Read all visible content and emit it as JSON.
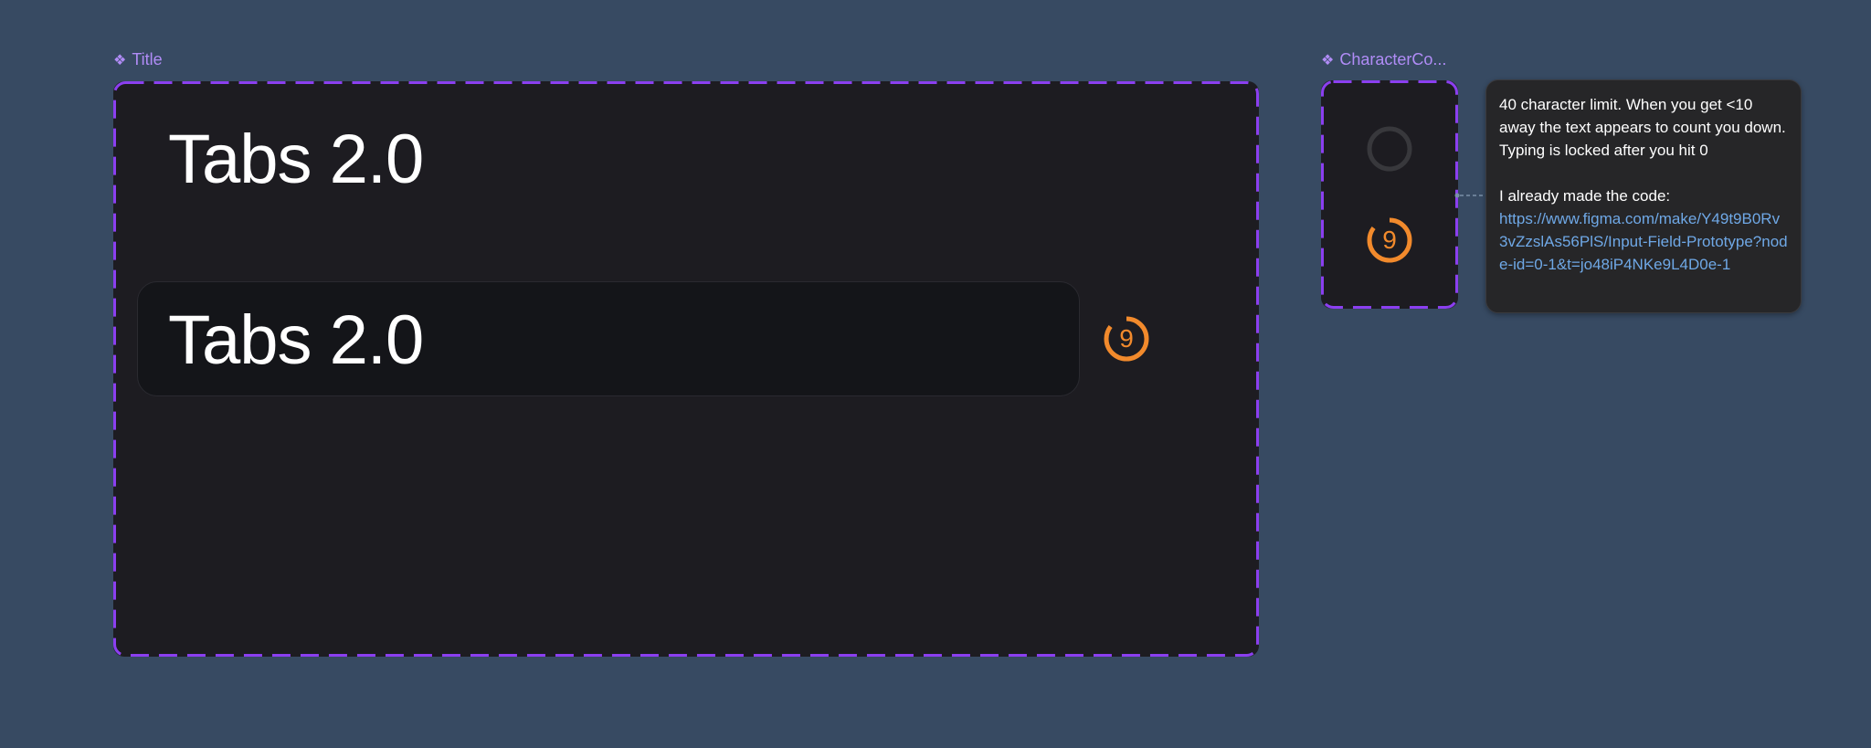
{
  "title_component": {
    "label_icon": "❖",
    "label": "Title",
    "heading_text": "Tabs 2.0",
    "input_text": "Tabs 2.0",
    "counter_value": "9"
  },
  "counter_component": {
    "label_icon": "❖",
    "label": "CharacterCo...",
    "counter_value": "9"
  },
  "note": {
    "line1": "40 character limit. When you get <10 away the text appears to count you down. Typing is locked after you hit 0",
    "line2": "I already made the code:",
    "link": "https://www.figma.com/make/Y49t9B0Rv3vZzslAs56PlS/Input-Field-Prototype?node-id=0-1&t=jo48iP4NKe9L4D0e-1"
  },
  "colors": {
    "canvas": "#374a62",
    "frame_bg": "#1d1c21",
    "component_border": "#8b3ff0",
    "counter_accent": "#f28a2c",
    "link": "#6fa8e6"
  }
}
